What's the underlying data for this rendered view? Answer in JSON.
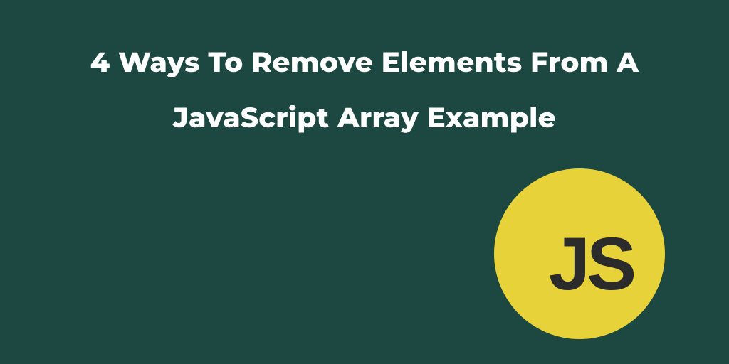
{
  "title": "4 Ways To Remove Elements From A JavaScript Array Example",
  "badge": {
    "label": "JS"
  },
  "colors": {
    "background": "#1d4841",
    "badge_bg": "#e8d23a",
    "badge_text": "#2b2b2b",
    "title_text": "#ffffff"
  }
}
